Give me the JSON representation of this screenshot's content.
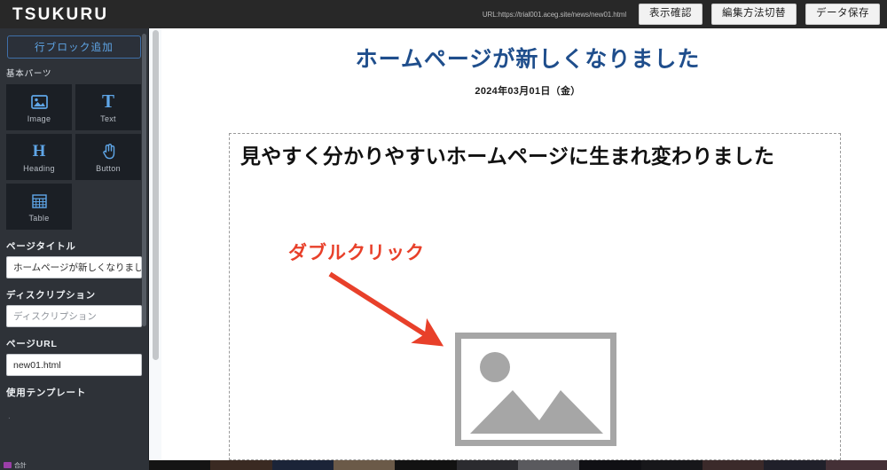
{
  "app": {
    "brand": "TSUKURU"
  },
  "topbar": {
    "url_text": "URL:https://trial001.aceg.site/news/new01.html",
    "buttons": [
      {
        "label": "表示確認",
        "name": "preview-button"
      },
      {
        "label": "編集方法切替",
        "name": "toggle-edit-mode-button"
      },
      {
        "label": "データ保存",
        "name": "save-data-button"
      }
    ]
  },
  "sidebar": {
    "add_row_block": "行ブロック追加",
    "basic_parts_label": "基本パーツ",
    "parts": [
      {
        "label": "Image",
        "icon": "image-icon"
      },
      {
        "label": "Text",
        "icon": "text-t-icon"
      },
      {
        "label": "Heading",
        "icon": "heading-h-icon"
      },
      {
        "label": "Button",
        "icon": "click-hand-icon"
      },
      {
        "label": "Table",
        "icon": "table-grid-icon"
      }
    ],
    "page_title": {
      "label": "ページタイトル",
      "value": "ホームページが新しくなりまし",
      "placeholder": "ページタイトル"
    },
    "description": {
      "label": "ディスクリプション",
      "value": "",
      "placeholder": "ディスクリプション"
    },
    "page_url": {
      "label": "ページURL",
      "value": "new01.html",
      "placeholder": "ページURL"
    },
    "template": {
      "label": "使用テンプレート",
      "value": "."
    }
  },
  "canvas": {
    "hero": {
      "title": "ホームページが新しくなりました",
      "date": "2024年03月01日（金）"
    },
    "block": {
      "heading": "見やすく分かりやすいホームページに生まれ変わりました"
    },
    "annotation": {
      "text": "ダブルクリック",
      "color": "#e8402a"
    },
    "image_placeholder": {
      "icon": "image-placeholder-icon"
    }
  },
  "taskbar": {
    "label": "合計"
  },
  "colors": {
    "topbar_bg": "#282828",
    "sidebar_bg": "#2e3238",
    "tile_bg": "#1b1f25",
    "accent_blue": "#5fa6e8",
    "hero_title": "#1f4e8c",
    "annotation_red": "#e8402a",
    "placeholder_gray": "#a6a6a6"
  }
}
